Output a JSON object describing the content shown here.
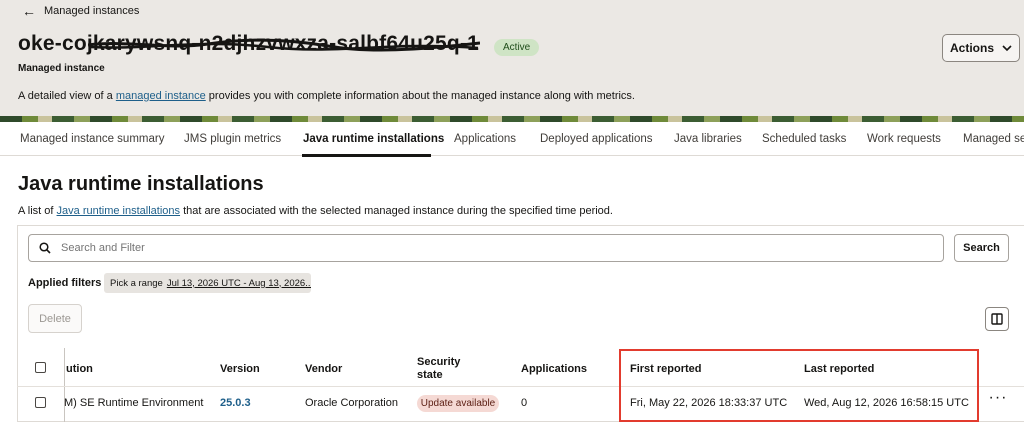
{
  "header": {
    "back_label": "Managed instances",
    "title": "oke-cojkarywsnq-n2djhzvwxza-salbf64u25q-1",
    "status": "Active",
    "subtitle": "Managed instance",
    "description_prefix": "A detailed view of a ",
    "description_link": "managed instance",
    "description_suffix": " provides you with complete information about the managed instance along with metrics.",
    "actions_label": "Actions"
  },
  "tabs": [
    "Managed instance summary",
    "JMS plugin metrics",
    "Java runtime installations",
    "Applications",
    "Deployed applications",
    "Java libraries",
    "Scheduled tasks",
    "Work requests",
    "Managed se"
  ],
  "active_tab": "Java runtime installations",
  "section": {
    "title": "Java runtime installations",
    "desc_prefix": "A list of ",
    "desc_link": "Java runtime installations",
    "desc_suffix": " that are associated with the selected managed instance during the specified time period."
  },
  "search": {
    "placeholder": "Search and Filter",
    "button_label": "Search"
  },
  "filters": {
    "label": "Applied filters",
    "chip_label": "Pick a range",
    "chip_value": "Jul 13, 2026 UTC - Aug 13, 2026..."
  },
  "toolbar": {
    "delete_label": "Delete"
  },
  "table": {
    "columns": [
      "ution",
      "Version",
      "Vendor",
      "Security state",
      "Applications",
      "First reported",
      "Last reported"
    ],
    "security_header_line1": "Security",
    "security_header_line2": "state",
    "rows": [
      {
        "distribution": "M) SE Runtime Environment",
        "version": "25.0.3",
        "vendor": "Oracle Corporation",
        "security_state": "Update available",
        "applications": "0",
        "first_reported": "Fri, May 22, 2026 18:33:37 UTC",
        "last_reported": "Wed, Aug 12, 2026 16:58:15 UTC"
      }
    ]
  },
  "colors": {
    "accent_link": "#1e5f8a",
    "active_badge": "#cfe4c5",
    "warning_badge": "#f5d9d4",
    "highlight_box": "#e23b2e"
  },
  "icons": {
    "back": "arrow-left-icon",
    "actions": "chevron-down-icon",
    "search": "search-icon",
    "columns": "columns-icon",
    "more": "more-horizontal-icon"
  }
}
